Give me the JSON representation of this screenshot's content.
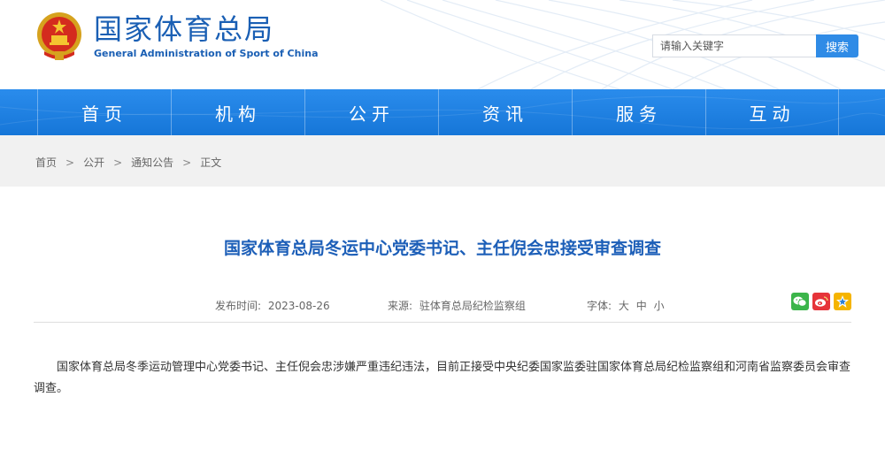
{
  "header": {
    "title_cn": "国家体育总局",
    "title_en": "General Administration of Sport of China",
    "emblem_icon": "national-emblem-icon"
  },
  "search": {
    "placeholder": "请输入关键字",
    "button_label": "搜索"
  },
  "nav": {
    "items": [
      {
        "label": "首页"
      },
      {
        "label": "机构"
      },
      {
        "label": "公开"
      },
      {
        "label": "资讯"
      },
      {
        "label": "服务"
      },
      {
        "label": "互动"
      }
    ]
  },
  "breadcrumb": {
    "items": [
      "首页",
      "公开",
      "通知公告",
      "正文"
    ],
    "separator": ">"
  },
  "article": {
    "title": "国家体育总局冬运中心党委书记、主任倪会忠接受审查调查",
    "date_label": "发布时间:",
    "date": "2023-08-26",
    "source_label": "来源:",
    "source": "驻体育总局纪检监察组",
    "font_label": "字体:",
    "font_sizes": [
      "大",
      "中",
      "小"
    ],
    "body": "国家体育总局冬季运动管理中心党委书记、主任倪会忠涉嫌严重违纪违法，目前正接受中央纪委国家监委驻国家体育总局纪检监察组和河南省监察委员会审查调查。"
  },
  "colors": {
    "brand_blue": "#1a5fb4",
    "nav_blue": "#1676d8",
    "title_blue": "#1d5fb8",
    "search_button": "#2f8be6"
  }
}
